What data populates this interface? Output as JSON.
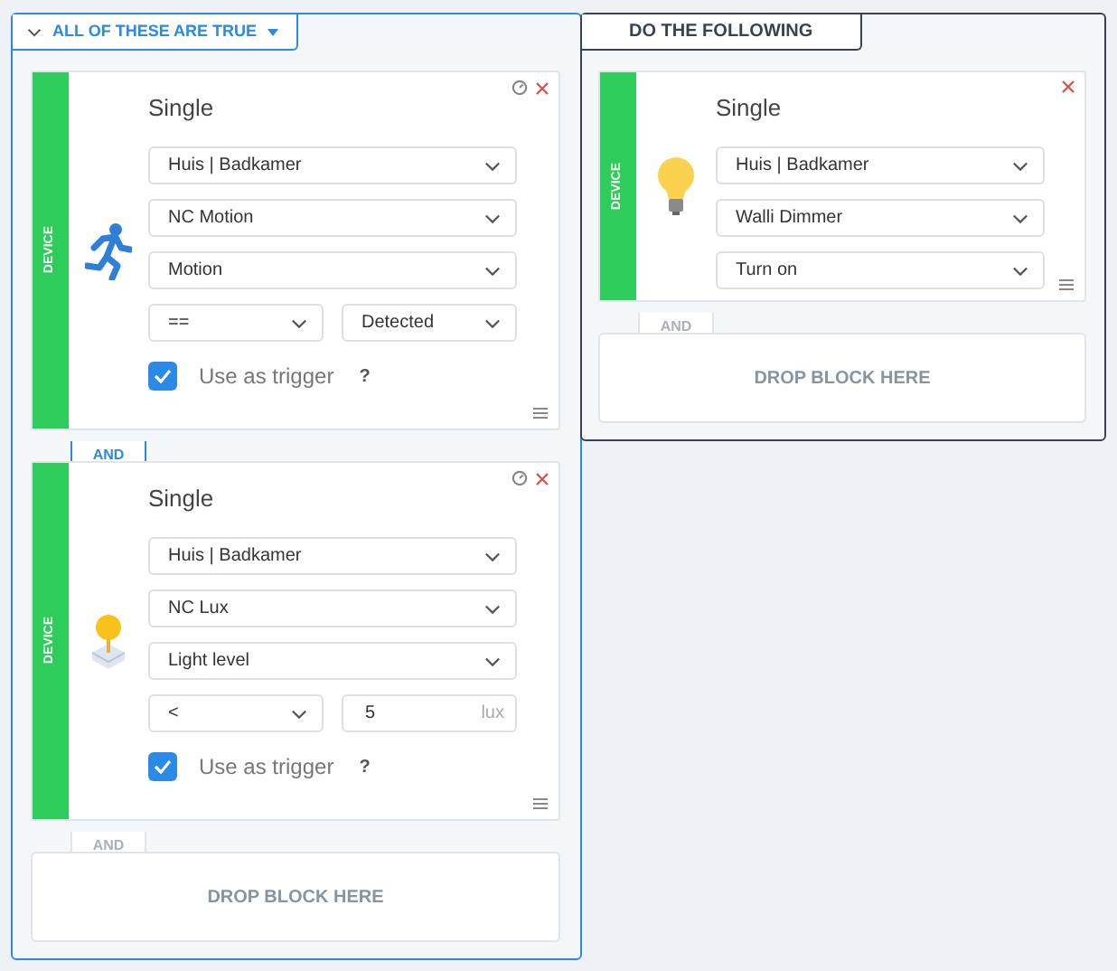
{
  "conditions": {
    "header": "ALL OF THESE ARE TRUE",
    "blocks": [
      {
        "category": "DEVICE",
        "kind": "motion",
        "title": "Single",
        "has_timer": true,
        "fields": [
          {
            "kind": "select",
            "value": "Huis | Badkamer"
          },
          {
            "kind": "select",
            "value": "NC Motion"
          },
          {
            "kind": "select",
            "value": "Motion"
          },
          {
            "kind": "compare",
            "operator": "==",
            "value": {
              "kind": "select",
              "value": "Detected"
            }
          }
        ],
        "trigger": {
          "label": "Use as trigger",
          "checked": true,
          "help": "?"
        },
        "connector": {
          "label": "AND",
          "active": true
        }
      },
      {
        "category": "DEVICE",
        "kind": "lux",
        "title": "Single",
        "has_timer": true,
        "fields": [
          {
            "kind": "select",
            "value": "Huis | Badkamer"
          },
          {
            "kind": "select",
            "value": "NC Lux"
          },
          {
            "kind": "select",
            "value": "Light level"
          },
          {
            "kind": "compare",
            "operator": "<",
            "value": {
              "kind": "input",
              "value": "5",
              "unit": "lux"
            }
          }
        ],
        "trigger": {
          "label": "Use as trigger",
          "checked": true,
          "help": "?"
        },
        "connector": {
          "label": "AND",
          "active": false
        }
      }
    ],
    "drop": "DROP BLOCK HERE"
  },
  "actions": {
    "header": "DO THE FOLLOWING",
    "blocks": [
      {
        "category": "DEVICE",
        "kind": "bulb",
        "title": "Single",
        "has_timer": false,
        "fields": [
          {
            "kind": "select",
            "value": "Huis | Badkamer"
          },
          {
            "kind": "select",
            "value": "Walli Dimmer"
          },
          {
            "kind": "select",
            "value": "Turn on"
          }
        ],
        "connector": {
          "label": "AND",
          "active": false
        }
      }
    ],
    "drop": "DROP BLOCK HERE"
  }
}
